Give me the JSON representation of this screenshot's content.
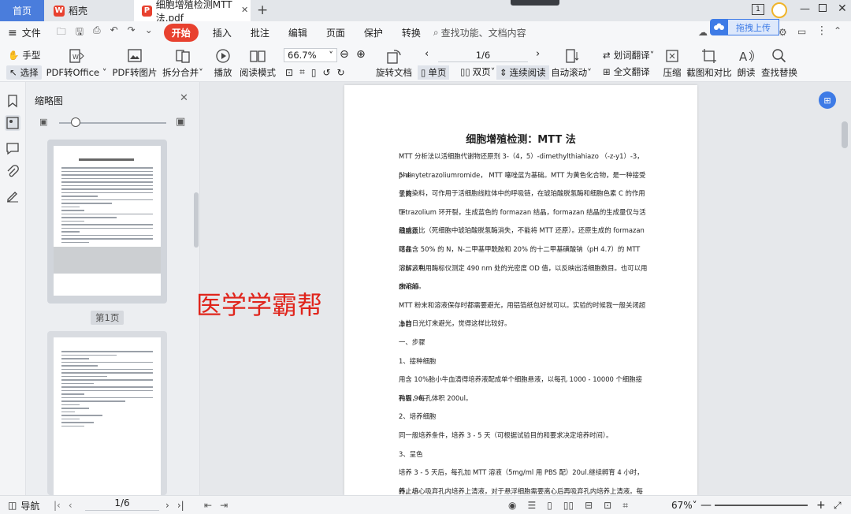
{
  "tabs": {
    "home": "首页",
    "daoke": "稻壳",
    "document": "细胞增殖检测MTT法.pdf"
  },
  "titlebar": {
    "page_indicator": "1"
  },
  "menubar": {
    "file": "文件",
    "start": "开始",
    "items": [
      "插入",
      "批注",
      "编辑",
      "页面",
      "保护",
      "转换"
    ],
    "search": "查找功能、文档内容"
  },
  "upload": {
    "label": "拖拽上传"
  },
  "toolbar": {
    "hand": "手型",
    "select": "选择",
    "pdf_to_office": "PDF转Office",
    "pdf_to_image": "PDF转图片",
    "split_merge": "拆分合并",
    "play": "播放",
    "read_mode": "阅读模式",
    "zoom": "66.7%",
    "rotate": "旋转文档",
    "page": "1/6",
    "single": "单页",
    "double": "双页",
    "continuous": "连续阅读",
    "auto_scroll": "自动滚动",
    "word_translate": "划词翻译",
    "full_translate": "全文翻译",
    "compress": "压缩",
    "screenshot": "截图和对比",
    "read_aloud": "朗读",
    "find_replace": "查找替换"
  },
  "thumbnails": {
    "title": "缩略图",
    "page1_label": "第1页"
  },
  "watermark": "医学学霸帮",
  "document": {
    "title": "细胞增殖检测：MTT 法",
    "lines": [
      "MTT 分析法以活细胞代谢物还原剂 3-（4，5）-dimethylthiahiazo （-z-y1）-3，5-di-",
      "phenytetrazoliumromide， MTT 噻唑蓝为基础。MTT 为黄色化合物，是一种接受氢离",
      "子的染料，可作用于活细胞线粒体中的呼吸链，在琥珀酸脱氢酶和细胞色素 C 的作用下",
      "tetrazolium 环开裂，生成蓝色的 formazan 结晶，formazan 结晶的生成量仅与活细胞数",
      "目成正比（死细胞中琥珀酸脱氢酶消失，不能将 MTT 还原）。还原生成的 formazan 结晶",
      "可在含 50% 的 N，N-二甲基甲酰胺和 20% 的十二甲基磺酸钠（pH 4.7）的 MTT 溶解液中",
      "溶解，利用酶标仪测定 490 nm 处的光密度 OD 值，以反映出活细胞数目。也可以用 DMSO",
      "来溶解。",
      "MTT 粉末和溶液保存时都需要避光，用铝箔纸包好就可以。实验的时候我一般关闭超净台",
      "上的日光灯来避光，觉得这样比较好。",
      "一、步骤",
      "1、接种细胞",
      "用含 10%胎小牛血清得培养液配成单个细胞悬液，以每孔 1000 - 10000 个细胞接种到 96",
      "孔板，每孔体积 200ul。",
      "2、培养细胞",
      "同一般培养条件，培养 3 - 5 天（可根据试验目的和要求决定培养时间）。",
      "3、呈色",
      "培养 3 - 5 天后，每孔加 MTT 溶液（5mg/ml 用 PBS 配）20ul.继续孵育 4 小时，终止培",
      "养，小心吸弃孔内培养上清液，对于悬浮细胞需要离心后再吸弃孔内培养上清液。每孔加"
    ]
  },
  "statusbar": {
    "nav": "导航",
    "page": "1/6",
    "zoom": "67%"
  }
}
